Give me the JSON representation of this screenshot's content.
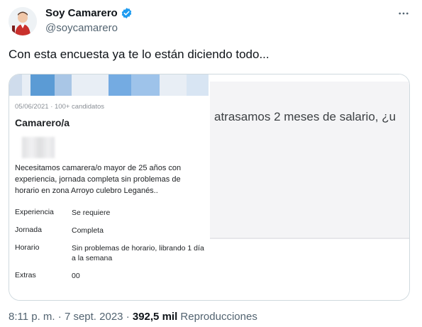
{
  "author": {
    "name": "Soy Camarero",
    "handle": "@soycamarero",
    "verified_color": "#1d9bf0"
  },
  "tweet": {
    "text": "Con esta encuesta ya te lo están diciendo todo...",
    "time": "8:11 p. m.",
    "separator1": "·",
    "date": "7 sept. 2023",
    "separator2": "·",
    "views": "392,5 mil",
    "views_label": "Reproducciones"
  },
  "job_card": {
    "date": "05/06/2021",
    "dot": "·",
    "candidates": "100+ candidatos",
    "title": "Camarero/a",
    "description": "Necesitamos camarera/o mayor de 25 años con experiencia, jornada completa sin problemas de horario en zona Arroyo culebro Leganés..",
    "details": [
      {
        "key": "Experiencia",
        "value": "Se requiere"
      },
      {
        "key": "Jornada",
        "value": "Completa"
      },
      {
        "key": "Horario",
        "value": "Sin problemas de horario, librando 1 día a la semana"
      },
      {
        "key": "Extras",
        "value": "00"
      }
    ]
  },
  "survey_image": {
    "text": "atrasamos 2 meses de salario, ¿u"
  },
  "icons": {
    "more": "more-horizontal-icon",
    "verified": "verified-badge-icon"
  }
}
